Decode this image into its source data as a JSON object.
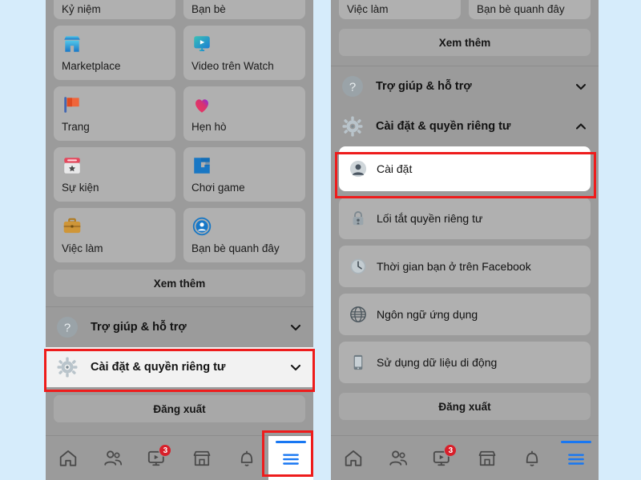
{
  "app": {
    "name": "Facebook",
    "language": "vi",
    "accent_blue": "#1877f2",
    "annotation_red": "#ee1c1c",
    "page_background": "#d6ecfb",
    "screen_background": "#9b9b9b",
    "tile_background": "#b0b0b0",
    "highlight_white": "#ffffff"
  },
  "left_phone": {
    "menu_grid_row_clipped": [
      {
        "label": "Kỷ niệm",
        "icon": "memories-icon"
      },
      {
        "label": "Bạn bè",
        "icon": "friends-icon"
      }
    ],
    "menu_grid": [
      {
        "label": "Marketplace",
        "icon": "marketplace-icon"
      },
      {
        "label": "Video trên Watch",
        "icon": "watch-video-icon"
      },
      {
        "label": "Trang",
        "icon": "pages-flag-icon"
      },
      {
        "label": "Hẹn hò",
        "icon": "dating-heart-icon"
      },
      {
        "label": "Sự kiện",
        "icon": "events-calendar-icon"
      },
      {
        "label": "Chơi game",
        "icon": "gaming-icon"
      },
      {
        "label": "Việc làm",
        "icon": "jobs-briefcase-icon"
      },
      {
        "label": "Bạn bè quanh đây",
        "icon": "nearby-friends-icon"
      }
    ],
    "see_more_label": "Xem thêm",
    "sections": [
      {
        "label": "Trợ giúp & hỗ trợ",
        "icon": "help-question-icon",
        "chevron": "chevron-down-icon",
        "expanded": false,
        "highlighted": false
      },
      {
        "label": "Cài đặt & quyền riêng tư",
        "icon": "settings-gear-icon",
        "chevron": "chevron-down-icon",
        "expanded": false,
        "highlighted": true
      }
    ],
    "logout_label": "Đăng xuất",
    "bottom_nav": [
      {
        "icon": "home-icon",
        "label": "Trang chủ",
        "badge": "",
        "active": false
      },
      {
        "icon": "friends-icon",
        "label": "Bạn bè",
        "badge": "",
        "active": false
      },
      {
        "icon": "watch-icon",
        "label": "Watch",
        "badge": "3",
        "active": false
      },
      {
        "icon": "marketplace-icon",
        "label": "Marketplace",
        "badge": "",
        "active": false
      },
      {
        "icon": "notifications-bell-icon",
        "label": "Thông báo",
        "badge": "",
        "active": false
      },
      {
        "icon": "menu-hamburger-icon",
        "label": "Menu",
        "badge": "",
        "active": true
      }
    ]
  },
  "right_phone": {
    "menu_grid_row_clipped": [
      {
        "label": "Việc làm",
        "icon": "jobs-briefcase-icon"
      },
      {
        "label": "Bạn bè quanh đây",
        "icon": "nearby-friends-icon"
      }
    ],
    "see_more_label": "Xem thêm",
    "sections": [
      {
        "label": "Trợ giúp & hỗ trợ",
        "icon": "help-question-icon",
        "chevron": "chevron-down-icon",
        "expanded": false,
        "highlighted": false
      },
      {
        "label": "Cài đặt & quyền riêng tư",
        "icon": "settings-gear-icon",
        "chevron": "chevron-up-icon",
        "expanded": true,
        "highlighted": false
      }
    ],
    "sub_items": [
      {
        "label": "Cài đặt",
        "icon": "account-avatar-icon",
        "highlighted": true
      },
      {
        "label": "Lối tắt quyền riêng tư",
        "icon": "privacy-lock-icon",
        "highlighted": false
      },
      {
        "label": "Thời gian bạn ở trên Facebook",
        "icon": "clock-icon",
        "highlighted": false
      },
      {
        "label": "Ngôn ngữ ứng dụng",
        "icon": "globe-language-icon",
        "highlighted": false
      },
      {
        "label": "Sử dụng dữ liệu di động",
        "icon": "mobile-data-icon",
        "highlighted": false
      }
    ],
    "logout_label": "Đăng xuất",
    "bottom_nav": [
      {
        "icon": "home-icon",
        "label": "Trang chủ",
        "badge": "",
        "active": false
      },
      {
        "icon": "friends-icon",
        "label": "Bạn bè",
        "badge": "",
        "active": false
      },
      {
        "icon": "watch-icon",
        "label": "Watch",
        "badge": "3",
        "active": false
      },
      {
        "icon": "marketplace-icon",
        "label": "Marketplace",
        "badge": "",
        "active": false
      },
      {
        "icon": "notifications-bell-icon",
        "label": "Thông báo",
        "badge": "",
        "active": false
      },
      {
        "icon": "menu-hamburger-icon",
        "label": "Menu",
        "badge": "",
        "active": true
      }
    ]
  },
  "annotations": [
    {
      "name": "settings-privacy-row-highlight-left",
      "target": "Cài đặt & quyền riêng tư"
    },
    {
      "name": "menu-tab-highlight-left",
      "target": "Menu"
    },
    {
      "name": "settings-item-highlight-right",
      "target": "Cài đặt"
    }
  ]
}
